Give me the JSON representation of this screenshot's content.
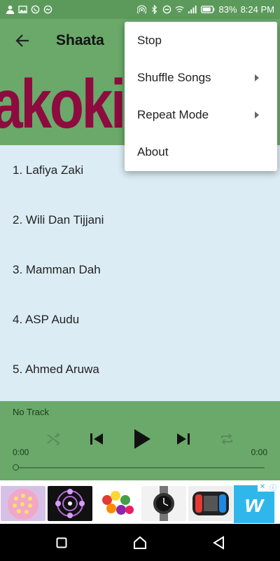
{
  "status_bar": {
    "battery": "83%",
    "time": "8:24 PM"
  },
  "app_bar": {
    "title": "Shaata"
  },
  "banner": {
    "text": "akokin Ma"
  },
  "songs": [
    {
      "label": "1. Lafiya Zaki"
    },
    {
      "label": "2. Wili Dan Tijjani"
    },
    {
      "label": "3. Mamman Dah"
    },
    {
      "label": "4. ASP Audu"
    },
    {
      "label": "5. Ahmed Aruwa"
    }
  ],
  "player": {
    "track": "No Track",
    "elapsed": "0:00",
    "duration": "0:00",
    "progress": 0
  },
  "menu": {
    "items": [
      {
        "label": "Stop",
        "has_submenu": false
      },
      {
        "label": "Shuffle Songs",
        "has_submenu": true
      },
      {
        "label": "Repeat Mode",
        "has_submenu": true
      },
      {
        "label": "About",
        "has_submenu": false
      }
    ]
  },
  "colors": {
    "status_bar": "#5c9a5c",
    "app_bar": "#6aa96a",
    "banner_text": "#8d0b3f",
    "list_bg": "#dcecf4",
    "ad_brand": "#2fb7ec"
  }
}
